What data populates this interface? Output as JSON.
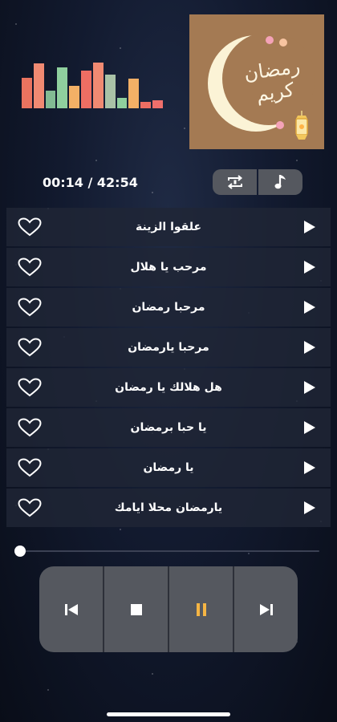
{
  "player": {
    "current_time": "00:14",
    "total_time": "42:54",
    "time_display": "00:14 / 42:54",
    "progress": 0.006
  },
  "artwork": {
    "line1": "رمضان",
    "line2": "كريم",
    "colors": {
      "background": "#a47a53",
      "moon": "#fbf3d6",
      "text": "#fdf6e3"
    }
  },
  "equalizer": {
    "levels": [
      0.63,
      0.93,
      0.37,
      0.85,
      0.47,
      0.78,
      0.95,
      0.7,
      0.22,
      0.62,
      0.13,
      0.17
    ],
    "colors": [
      "#e9735f",
      "#f08a72",
      "#82bb93",
      "#8fcf9e",
      "#f3b066",
      "#ee6e63",
      "#f08a72",
      "#a9c2a7",
      "#8fcf9e",
      "#f3b066",
      "#ee6e63",
      "#ef6f6b"
    ]
  },
  "controls": {
    "repeat_icon": "repeat-icon",
    "music_icon": "music-note-icon",
    "transport": [
      {
        "name": "previous-button",
        "icon": "skip-previous-icon"
      },
      {
        "name": "stop-button",
        "icon": "stop-icon"
      },
      {
        "name": "pause-button",
        "icon": "pause-icon"
      },
      {
        "name": "next-button",
        "icon": "skip-next-icon"
      }
    ]
  },
  "tracks": [
    {
      "title": "علقوا الزينة"
    },
    {
      "title": "مرحب يا هلال"
    },
    {
      "title": "مرحبا رمضان"
    },
    {
      "title": "مرحبا يارمضان"
    },
    {
      "title": "هل هلالك يا رمضان"
    },
    {
      "title": "يا حبا برمضان"
    },
    {
      "title": "يا رمضان"
    },
    {
      "title": "يارمضان محلا ايامك"
    }
  ],
  "colors": {
    "accent": "#f5b544",
    "panel": "#55585f",
    "row": "#202636"
  }
}
